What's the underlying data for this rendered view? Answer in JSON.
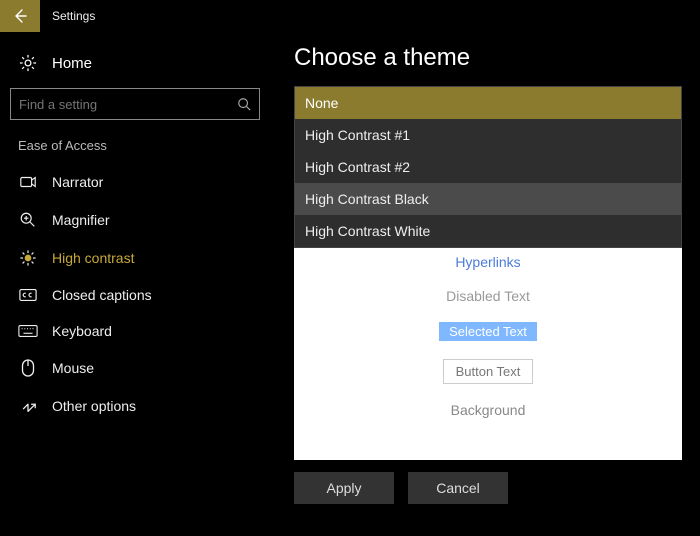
{
  "title": "Settings",
  "sidebar": {
    "home": "Home",
    "search_placeholder": "Find a setting",
    "section": "Ease of Access",
    "items": [
      {
        "label": "Narrator"
      },
      {
        "label": "Magnifier"
      },
      {
        "label": "High contrast"
      },
      {
        "label": "Closed captions"
      },
      {
        "label": "Keyboard"
      },
      {
        "label": "Mouse"
      },
      {
        "label": "Other options"
      }
    ]
  },
  "main": {
    "heading": "Choose a theme",
    "theme_options": [
      "None",
      "High Contrast #1",
      "High Contrast #2",
      "High Contrast Black",
      "High Contrast White"
    ],
    "selected_theme": "None",
    "preview": {
      "hyperlinks": "Hyperlinks",
      "disabled": "Disabled Text",
      "selected": "Selected Text",
      "button": "Button Text",
      "background": "Background"
    },
    "buttons": {
      "apply": "Apply",
      "cancel": "Cancel"
    }
  }
}
